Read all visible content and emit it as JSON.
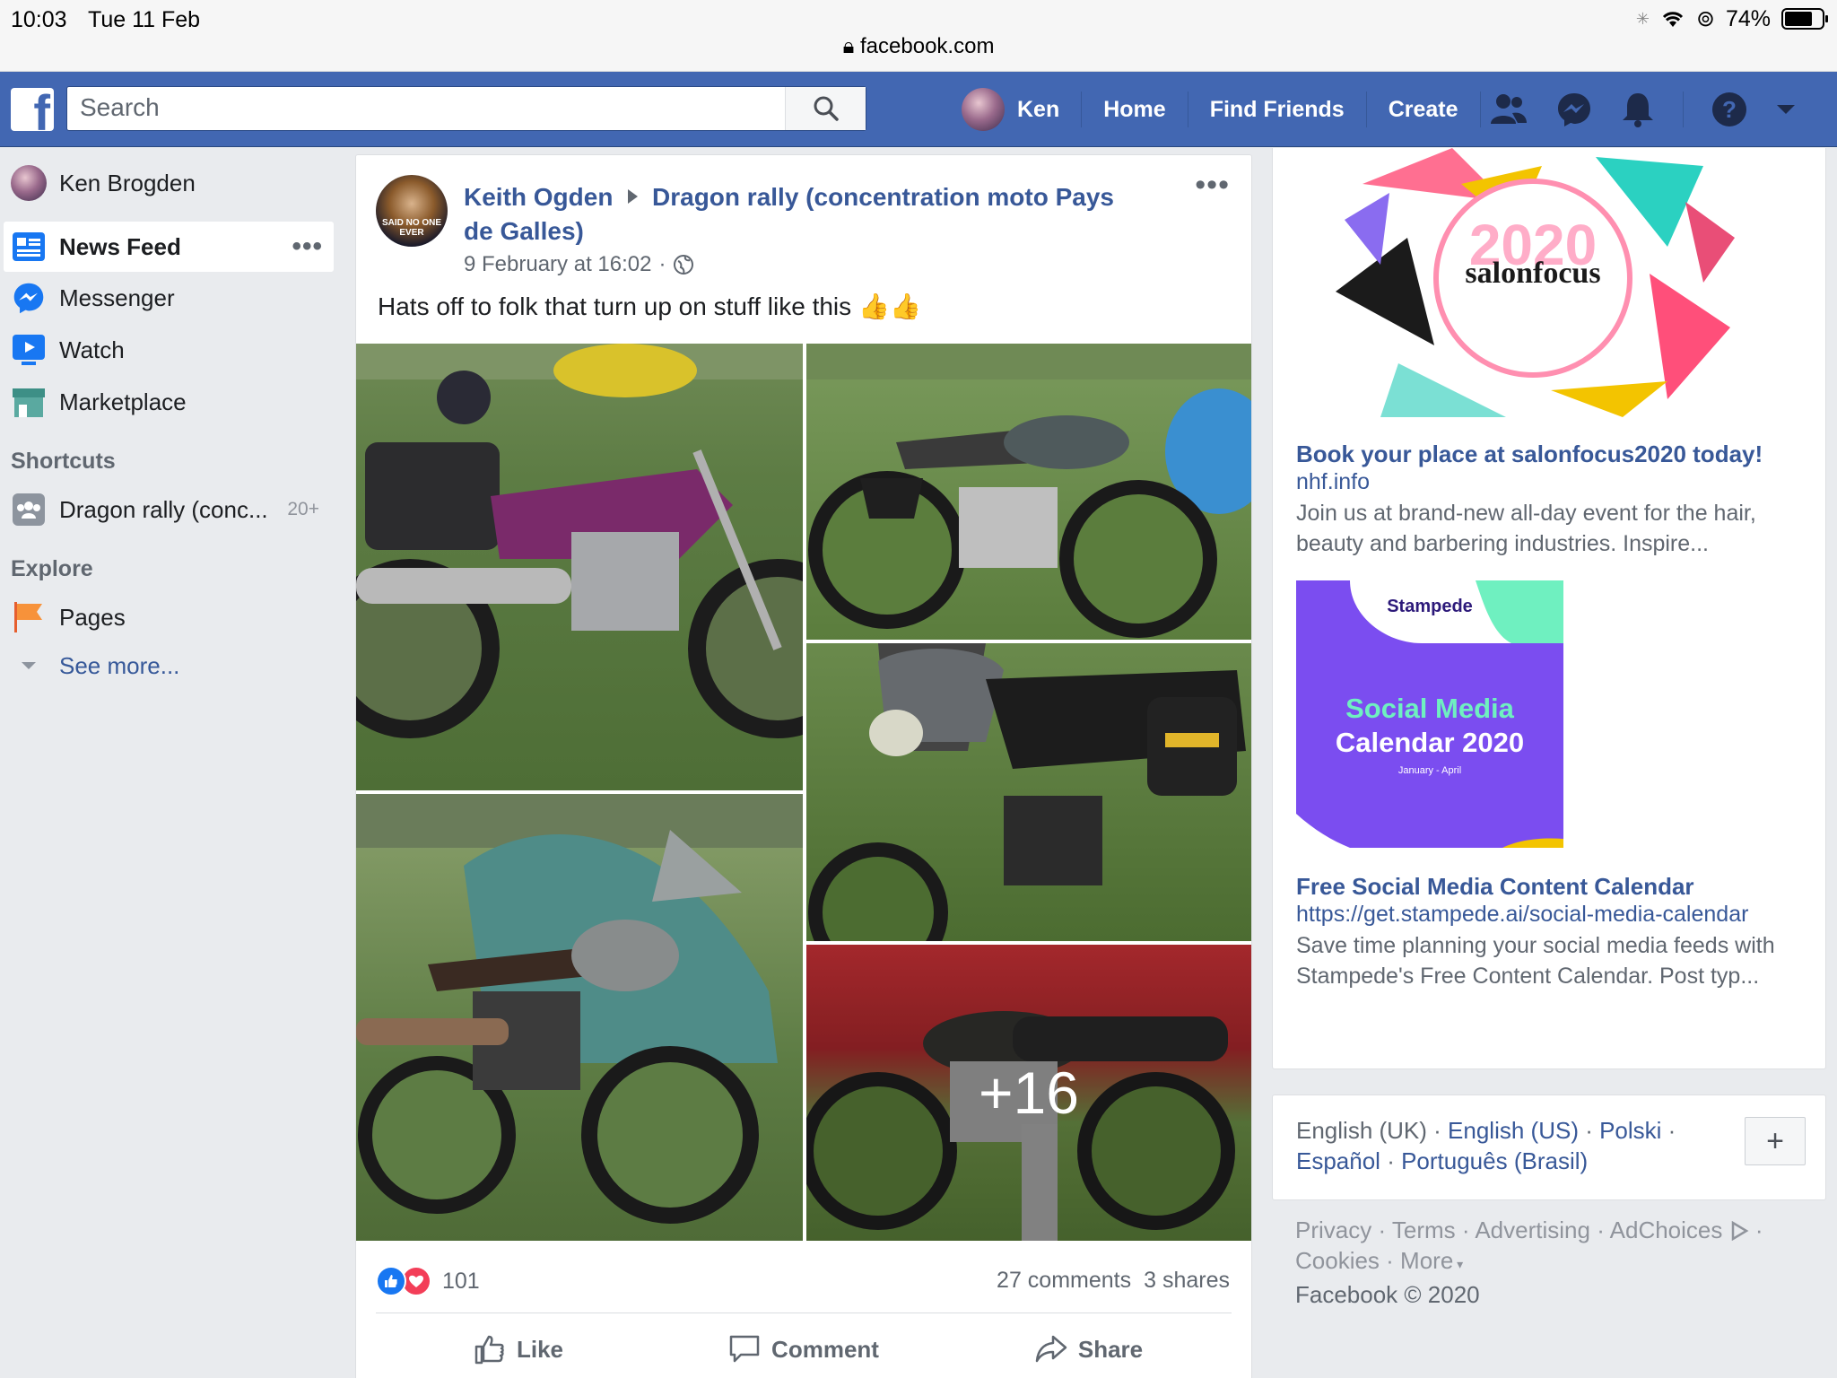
{
  "status_bar": {
    "time": "10:03",
    "date": "Tue 11 Feb",
    "battery": "74%",
    "battery_level": 0.74,
    "url": "facebook.com"
  },
  "topbar": {
    "search_placeholder": "Search",
    "user": "Ken",
    "nav": [
      "Home",
      "Find Friends",
      "Create"
    ],
    "icons": [
      "friends-icon",
      "messenger-icon",
      "notifications-icon",
      "help-icon",
      "dropdown-icon"
    ]
  },
  "sidebar": {
    "profile_name": "Ken Brogden",
    "items": [
      {
        "label": "News Feed"
      },
      {
        "label": "Messenger"
      },
      {
        "label": "Watch"
      },
      {
        "label": "Marketplace"
      }
    ],
    "shortcuts_heading": "Shortcuts",
    "shortcut": {
      "label": "Dragon rally (conc...",
      "badge": "20+"
    },
    "explore_heading": "Explore",
    "explore_items": [
      {
        "label": "Pages"
      }
    ],
    "see_more": "See more..."
  },
  "post": {
    "author": "Keith Ogden",
    "group": "Dragon rally (concentration moto Pays de Galles)",
    "timestamp": "9 February at 16:02",
    "avatar_text": "SAID NO ONE EVER",
    "text": "Hats off to folk that turn up on stuff like this",
    "emoji": "👍👍",
    "more_photos": "+16",
    "reaction_count": "101",
    "comments": "27 comments",
    "shares": "3 shares",
    "actions": {
      "like": "Like",
      "comment": "Comment",
      "share": "Share"
    }
  },
  "ads": [
    {
      "image_text": "salonfocus",
      "title": "Book your place at salonfocus2020 today!",
      "link": "nhf.info",
      "body": "Join us at brand-new all-day event for the hair, beauty and barbering industries. Inspire..."
    },
    {
      "image_brand": "Stampede",
      "image_line1": "Social Media",
      "image_line2": "Calendar 2020",
      "image_sub": "January - April",
      "title": "Free Social Media Content Calendar",
      "link": "https://get.stampede.ai/social-media-calendar",
      "body": "Save time planning your social media feeds with Stampede's Free Content Calendar. Post typ..."
    }
  ],
  "languages": {
    "current": "English (UK)",
    "others": [
      "English (US)",
      "Polski",
      "Español",
      "Português (Brasil)"
    ],
    "sep": " · "
  },
  "footer": {
    "links": [
      "Privacy",
      "Terms",
      "Advertising",
      "AdChoices",
      "Cookies",
      "More"
    ],
    "copyright": "Facebook © 2020"
  }
}
